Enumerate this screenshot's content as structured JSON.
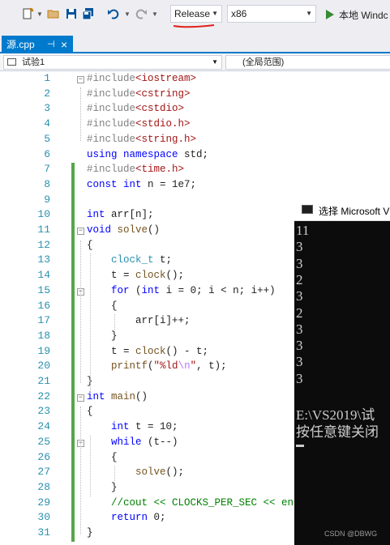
{
  "toolbar": {
    "config_combo": "Release",
    "platform_combo": "x86",
    "run_label": "本地 Windc"
  },
  "tab": {
    "label": "源.cpp",
    "pin": "⊣",
    "close": "×"
  },
  "navbar": {
    "project": "试验1",
    "scope": "(全局范围)"
  },
  "editor": {
    "lines": [
      {
        "n": "1",
        "html": "<span class='pp'>#include</span><span class='str'>&lt;iostream&gt;</span>"
      },
      {
        "n": "2",
        "html": "<span class='pp'>#include</span><span class='str'>&lt;cstring&gt;</span>"
      },
      {
        "n": "3",
        "html": "<span class='pp'>#include</span><span class='str'>&lt;cstdio&gt;</span>"
      },
      {
        "n": "4",
        "html": "<span class='pp'>#include</span><span class='str'>&lt;stdio.h&gt;</span>"
      },
      {
        "n": "5",
        "html": "<span class='pp'>#include</span><span class='str'>&lt;string.h&gt;</span>"
      },
      {
        "n": "6",
        "html": "<span class='kw'>using</span> <span class='kw'>namespace</span> std;"
      },
      {
        "n": "7",
        "html": "<span class='pp'>#include</span><span class='str'>&lt;time.h&gt;</span>"
      },
      {
        "n": "8",
        "html": "<span class='kw'>const</span> <span class='kw'>int</span> n = 1e7;"
      },
      {
        "n": "9",
        "html": ""
      },
      {
        "n": "10",
        "html": "<span class='kw'>int</span> arr[n];"
      },
      {
        "n": "11",
        "html": "<span class='kw'>void</span> <span class='fn'>solve</span>()"
      },
      {
        "n": "12",
        "html": "{"
      },
      {
        "n": "13",
        "html": "    <span class='id'>clock_t</span> t;"
      },
      {
        "n": "14",
        "html": "    t = <span class='fn'>clock</span>();"
      },
      {
        "n": "15",
        "html": "    <span class='kw'>for</span> (<span class='kw'>int</span> i = 0; i &lt; n; i++)"
      },
      {
        "n": "16",
        "html": "    {"
      },
      {
        "n": "17",
        "html": "        arr[i]++;"
      },
      {
        "n": "18",
        "html": "    }"
      },
      {
        "n": "19",
        "html": "    t = <span class='fn'>clock</span>() - t;"
      },
      {
        "n": "20",
        "html": "    <span class='fn'>printf</span>(<span class='str'>\"%ld</span><span class='esc'>\\n</span><span class='str'>\"</span>, t);"
      },
      {
        "n": "21",
        "html": "}"
      },
      {
        "n": "22",
        "html": "<span class='kw'>int</span> <span class='fn'>main</span>()"
      },
      {
        "n": "23",
        "html": "{"
      },
      {
        "n": "24",
        "html": "    <span class='kw'>int</span> t = 10;"
      },
      {
        "n": "25",
        "html": "    <span class='kw'>while</span> (t--)"
      },
      {
        "n": "26",
        "html": "    {"
      },
      {
        "n": "27",
        "html": "        <span class='fn'>solve</span>();"
      },
      {
        "n": "28",
        "html": "    }"
      },
      {
        "n": "29",
        "html": "    <span class='cm'>//cout &lt;&lt; CLOCKS_PER_SEC &lt;&lt; en</span>"
      },
      {
        "n": "30",
        "html": "    <span class='kw'>return</span> 0;"
      },
      {
        "n": "31",
        "html": "}"
      }
    ]
  },
  "console": {
    "title": "选择 Microsoft V",
    "lines": [
      "11",
      "3",
      "3",
      "2",
      "3",
      "2",
      "3",
      "3",
      "3",
      "3",
      "",
      "E:\\VS2019\\试",
      "按任意键关闭"
    ]
  },
  "watermark": "CSDN @DBWG",
  "colors": {
    "accent": "#007acc",
    "change_bar": "#57a64a",
    "console_bg": "#0c0c0c"
  }
}
